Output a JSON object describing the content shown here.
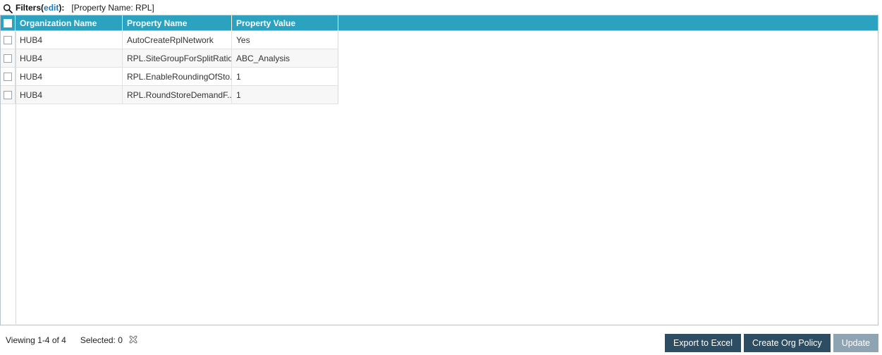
{
  "filters": {
    "icon": "search-icon",
    "label": "Filters",
    "open_paren": "(",
    "edit_link": "edit",
    "close_paren": ")",
    "colon": ":",
    "active_filter": "[Property Name: RPL]"
  },
  "grid": {
    "select_all_checkbox": false,
    "columns": [
      {
        "key": "organization_name",
        "label": "Organization Name"
      },
      {
        "key": "property_name",
        "label": "Property Name"
      },
      {
        "key": "property_value",
        "label": "Property Value"
      }
    ],
    "rows": [
      {
        "selected": false,
        "organization_name": "HUB4",
        "property_name": "AutoCreateRplNetwork",
        "property_value": "Yes"
      },
      {
        "selected": false,
        "organization_name": "HUB4",
        "property_name": "RPL.SiteGroupForSplitRatio",
        "property_value": "ABC_Analysis"
      },
      {
        "selected": false,
        "organization_name": "HUB4",
        "property_name": "RPL.EnableRoundingOfSto...",
        "property_value": "1"
      },
      {
        "selected": false,
        "organization_name": "HUB4",
        "property_name": "RPL.RoundStoreDemandF...",
        "property_value": "1"
      }
    ]
  },
  "footer": {
    "viewing": "Viewing 1-4 of 4",
    "selected": "Selected: 0",
    "clear_icon": "clear-selection-icon",
    "buttons": [
      {
        "label": "Export to Excel",
        "state": "enabled"
      },
      {
        "label": "Create Org Policy",
        "state": "enabled"
      },
      {
        "label": "Update",
        "state": "disabled"
      }
    ]
  },
  "colors": {
    "header_teal": "#2ba3c0",
    "button_primary": "#2d4d63",
    "button_disabled": "#8fa4b2",
    "link_blue": "#1a7bc4",
    "row_alt": "#f7f7f7",
    "panel_border": "#b9c3cb"
  }
}
